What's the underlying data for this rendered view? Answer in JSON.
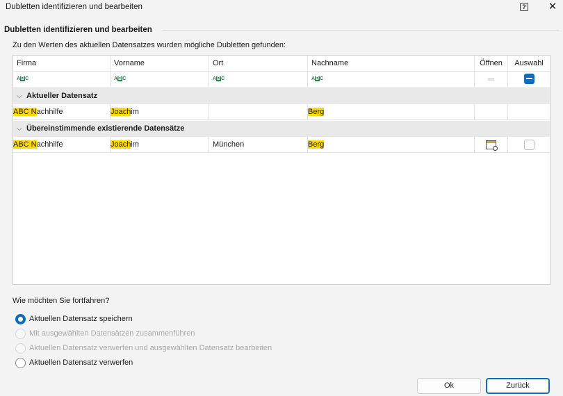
{
  "window": {
    "title": "Dubletten identifizieren und bearbeiten",
    "help": "?",
    "close": "✕"
  },
  "group": {
    "title": "Dubletten identifizieren und bearbeiten"
  },
  "intro": "Zu den Werten des aktuellen Datensatzes wurden mögliche Dubletten gefunden:",
  "grid": {
    "columns": {
      "firma": "Firma",
      "vorname": "Vorname",
      "ort": "Ort",
      "nachname": "Nachname",
      "oeffnen": "Öffnen",
      "auswahl": "Auswahl"
    },
    "filter_icon": {
      "a": "A",
      "b": "B",
      "c": "C"
    },
    "filter_oeffnen": "═",
    "groups": {
      "current": "Aktueller Datensatz",
      "existing": "Übereinstimmende existierende Datensätze"
    },
    "current_row": {
      "firma_hl": "ABC N",
      "firma_rest": "achhilfe",
      "vorname_hl": "Joach",
      "vorname_rest": "im",
      "ort": "",
      "nachname_hl": "Berg",
      "nachname_rest": ""
    },
    "existing_row": {
      "firma_hl": "ABC N",
      "firma_rest": "achhilfe",
      "vorname_hl": "Joach",
      "vorname_rest": "im",
      "ort": "München",
      "nachname_hl": "Berg",
      "nachname_rest": ""
    }
  },
  "options": {
    "question": "Wie möchten Sie fortfahren?",
    "items": [
      {
        "label": "Aktuellen Datensatz speichern"
      },
      {
        "label": "Mit ausgewählten Datensätzen zusammenführen"
      },
      {
        "label": "Aktuellen Datensatz verwerfen und ausgewählten Datensatz bearbeiten"
      },
      {
        "label": "Aktuellen Datensatz verwerfen"
      }
    ]
  },
  "buttons": {
    "ok": "Ok",
    "back": "Zurück"
  },
  "colors": {
    "accent": "#0f6cbd",
    "highlight": "#ffd900",
    "abc_icon": "#1f8a4c"
  }
}
